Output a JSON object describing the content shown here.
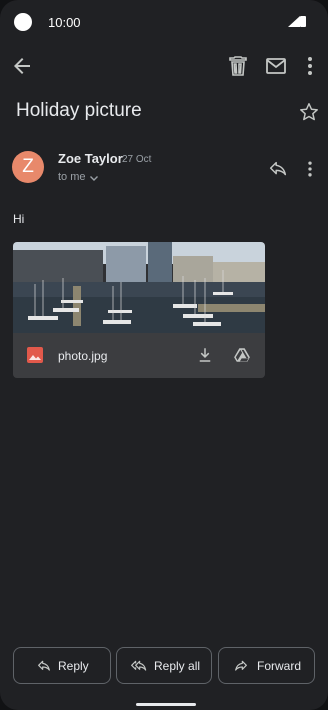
{
  "status_bar": {
    "time": "10:00"
  },
  "email": {
    "subject": "Holiday picture",
    "sender_initial": "Z",
    "sender_name": "Zoe Taylor",
    "date": "27 Oct",
    "recipient_label": "to me",
    "body": "Hi",
    "attachment": {
      "filename": "photo.jpg"
    }
  },
  "actions": {
    "reply": "Reply",
    "reply_all": "Reply all",
    "forward": "Forward"
  },
  "colors": {
    "background": "#202124",
    "avatar": "#e8896b",
    "image_icon": "#e2594b"
  }
}
